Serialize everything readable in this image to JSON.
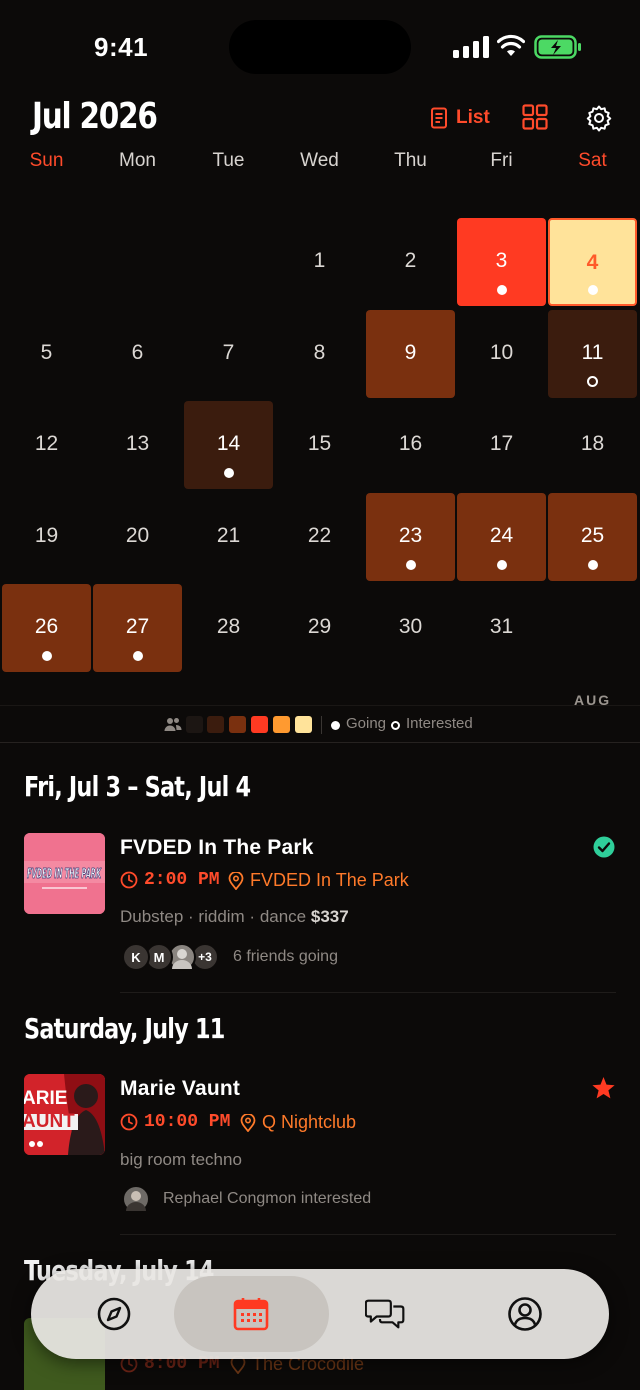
{
  "status_bar": {
    "time": "9:41"
  },
  "header": {
    "month_title": "Jul 2026",
    "list_label": "List"
  },
  "weekdays": [
    "Sun",
    "Mon",
    "Tue",
    "Wed",
    "Thu",
    "Fri",
    "Sat"
  ],
  "calendar": {
    "days": [
      "1",
      "2",
      "3",
      "4",
      "5",
      "6",
      "7",
      "8",
      "9",
      "10",
      "11",
      "12",
      "13",
      "14",
      "15",
      "16",
      "17",
      "18",
      "19",
      "20",
      "21",
      "22",
      "23",
      "24",
      "25",
      "26",
      "27",
      "28",
      "29",
      "30",
      "31"
    ],
    "next_month_label": "AUG"
  },
  "legend": {
    "going_label": "Going",
    "interested_label": "Interested"
  },
  "sections": [
    {
      "title": "Fri, Jul 3 – Sat, Jul 4",
      "event": {
        "thumb_text": "FVDED IN THE PARK",
        "title": "FVDED In The Park",
        "time": "2:00 PM",
        "venue": "FVDED In The Park",
        "tags": "Dubstep · riddim · dance",
        "price": "$337",
        "avatars": [
          "K",
          "M",
          "+3"
        ],
        "social": "6 friends going",
        "status_icon": "check-circle-icon"
      }
    },
    {
      "title": "Saturday, July 11",
      "event": {
        "thumb_text": "ARIE AUNT",
        "title": "Marie Vaunt",
        "time": "10:00 PM",
        "venue": "Q Nightclub",
        "tags": "big room techno",
        "social": "Rephael Congmon interested",
        "status_icon": "star-icon"
      }
    },
    {
      "title": "Tuesday, July 14",
      "event": {
        "time": "8:00 PM",
        "venue": "The Crocodile"
      }
    }
  ],
  "nav": {
    "items": [
      "discover-icon",
      "calendar-icon",
      "messages-icon",
      "profile-icon"
    ],
    "active": "calendar-icon"
  },
  "colors": {
    "accent": "#ff4b2b",
    "venue": "#ff7a2a",
    "cal_red": "#ff3a22",
    "cal_yellow": "#ffe39a",
    "cal_brown": "#7a300f",
    "cal_dark": "#3b1c0e"
  }
}
